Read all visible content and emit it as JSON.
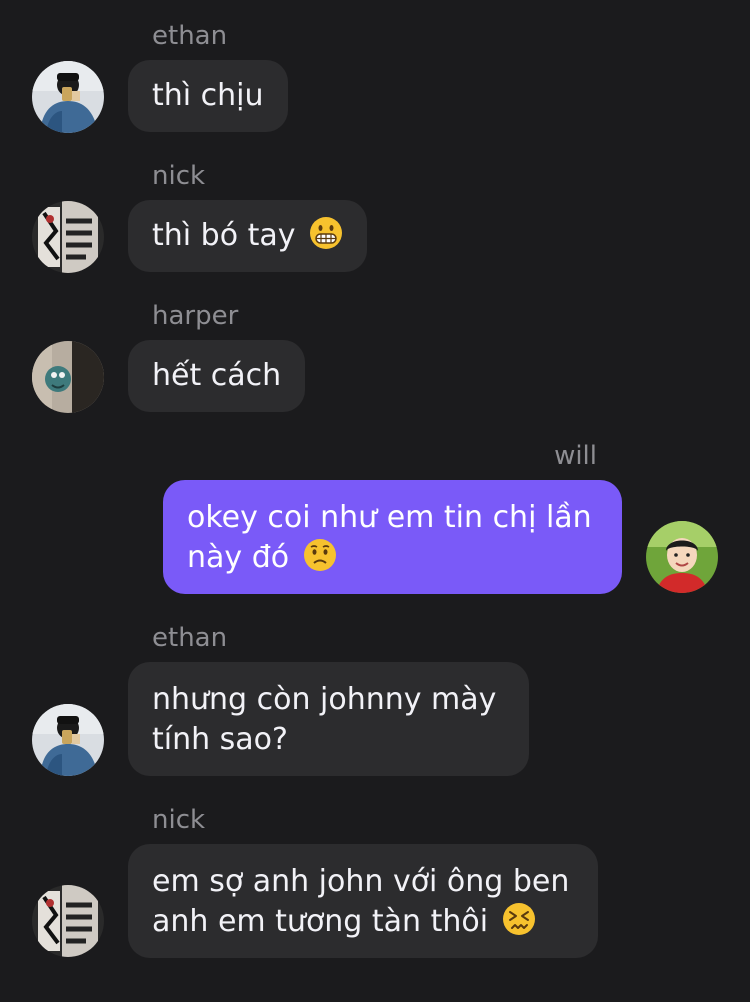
{
  "messages": [
    {
      "sender": "ethan",
      "text": "thì chịu",
      "emoji": ""
    },
    {
      "sender": "nick",
      "text": "thì bó tay",
      "emoji": "grimacing-face"
    },
    {
      "sender": "harper",
      "text": "hết cách",
      "emoji": ""
    },
    {
      "sender": "will",
      "line1": "okey coi như em tin chị lần",
      "line2": "này đó",
      "emoji": "worried-face"
    },
    {
      "sender": "ethan",
      "line1": "nhưng còn johnny mày",
      "line2": "tính sao?",
      "emoji": ""
    },
    {
      "sender": "nick",
      "line1": "em sợ anh john với ông ben",
      "line2": "anh em tương tàn thôi",
      "emoji": "confounded-face"
    }
  ],
  "colors": {
    "background": "#1b1b1d",
    "incoming_bubble": "#2c2c2e",
    "outgoing_bubble": "#7a5af8",
    "sender_name": "#8e8e93",
    "message_text": "#f2f2f7"
  }
}
